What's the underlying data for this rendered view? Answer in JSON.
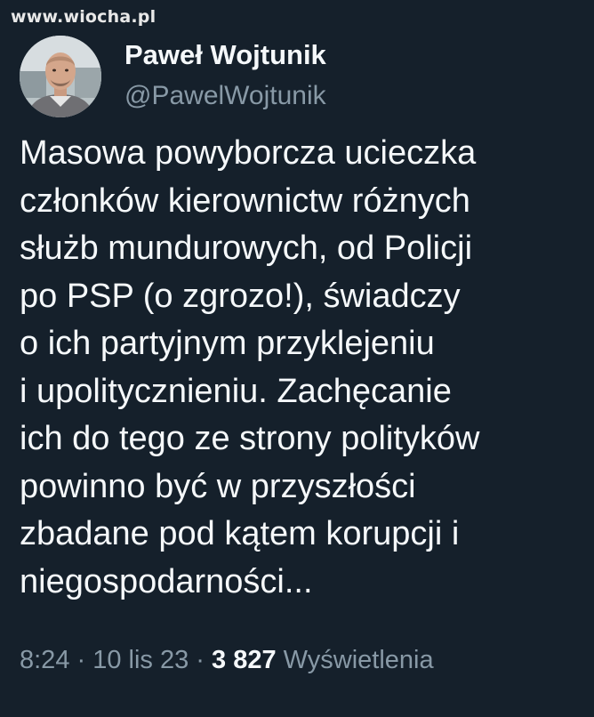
{
  "watermark": "www.wiocha.pl",
  "author": {
    "name": "Paweł Wojtunik",
    "handle": "@PawelWojtunik"
  },
  "tweet": {
    "lines": [
      "Masowa powyborcza ucieczka",
      "członków kierownictw różnych",
      "służb mundurowych, od Policji",
      "po PSP (o zgrozo!), świadczy",
      "o ich partyjnym przyklejeniu",
      "i upolitycznieniu. Zachęcanie",
      "ich do tego ze strony polityków",
      "powinno być w przyszłości",
      "zbadane pod kątem korupcji i",
      "niegospodarności..."
    ]
  },
  "meta": {
    "time": "8:24",
    "separator": " · ",
    "date": "10 lis 23",
    "views_count": "3 827",
    "views_label": "Wyświetlenia"
  },
  "colors": {
    "background": "#15202b",
    "text": "#f5f8fa",
    "secondary": "#8899a6"
  }
}
